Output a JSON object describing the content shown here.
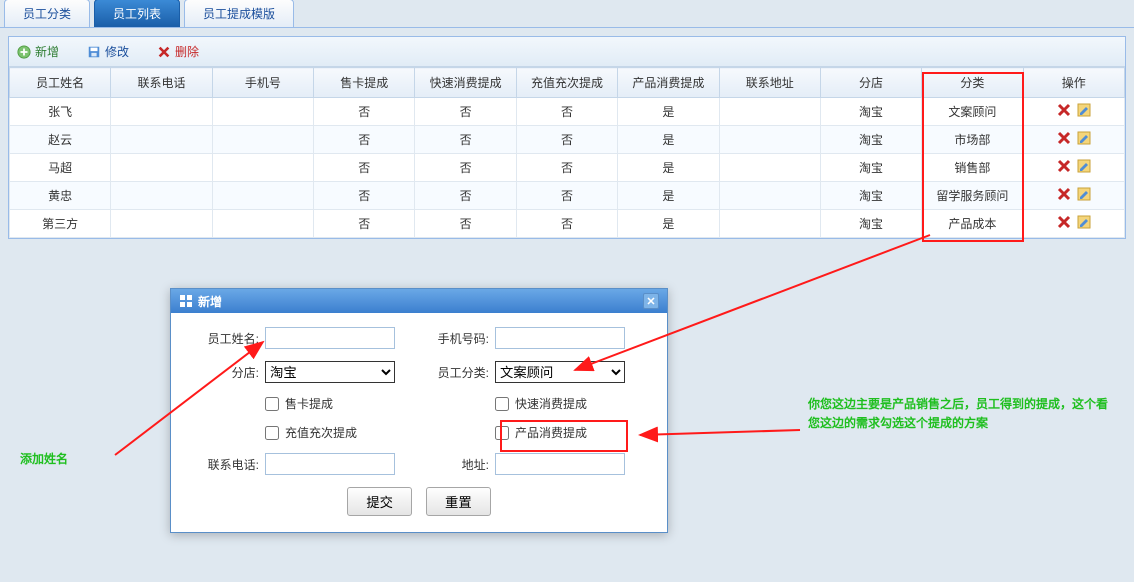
{
  "tabs": [
    "员工分类",
    "员工列表",
    "员工提成模版"
  ],
  "active_tab": 1,
  "toolbar": {
    "add": "新增",
    "edit": "修改",
    "del": "删除"
  },
  "columns": [
    "员工姓名",
    "联系电话",
    "手机号",
    "售卡提成",
    "快速消费提成",
    "充值充次提成",
    "产品消费提成",
    "联系地址",
    "分店",
    "分类",
    "操作"
  ],
  "rows": [
    {
      "name": "张飞",
      "phone": "",
      "mobile": "",
      "c1": "否",
      "c2": "否",
      "c3": "否",
      "c4": "是",
      "addr": "",
      "shop": "淘宝",
      "cat": "文案顾问"
    },
    {
      "name": "赵云",
      "phone": "",
      "mobile": "",
      "c1": "否",
      "c2": "否",
      "c3": "否",
      "c4": "是",
      "addr": "",
      "shop": "淘宝",
      "cat": "市场部"
    },
    {
      "name": "马超",
      "phone": "",
      "mobile": "",
      "c1": "否",
      "c2": "否",
      "c3": "否",
      "c4": "是",
      "addr": "",
      "shop": "淘宝",
      "cat": "销售部"
    },
    {
      "name": "黄忠",
      "phone": "",
      "mobile": "",
      "c1": "否",
      "c2": "否",
      "c3": "否",
      "c4": "是",
      "addr": "",
      "shop": "淘宝",
      "cat": "留学服务顾问"
    },
    {
      "name": "第三方",
      "phone": "",
      "mobile": "",
      "c1": "否",
      "c2": "否",
      "c3": "否",
      "c4": "是",
      "addr": "",
      "shop": "淘宝",
      "cat": "产品成本"
    }
  ],
  "dialog": {
    "title": "新增",
    "fields": {
      "name_label": "员工姓名:",
      "mobile_label": "手机号码:",
      "shop_label": "分店:",
      "shop_value": "淘宝",
      "cat_label": "员工分类:",
      "cat_value": "文案顾问",
      "chk_card": "售卡提成",
      "chk_fast": "快速消费提成",
      "chk_charge": "充值充次提成",
      "chk_product": "产品消费提成",
      "phone_label": "联系电话:",
      "addr_label": "地址:"
    },
    "buttons": {
      "submit": "提交",
      "reset": "重置"
    }
  },
  "annotations": {
    "left": "添加姓名",
    "right": "你您这边主要是产品销售之后，员工得到的提成，这个看您这边的需求勾选这个提成的方案"
  }
}
